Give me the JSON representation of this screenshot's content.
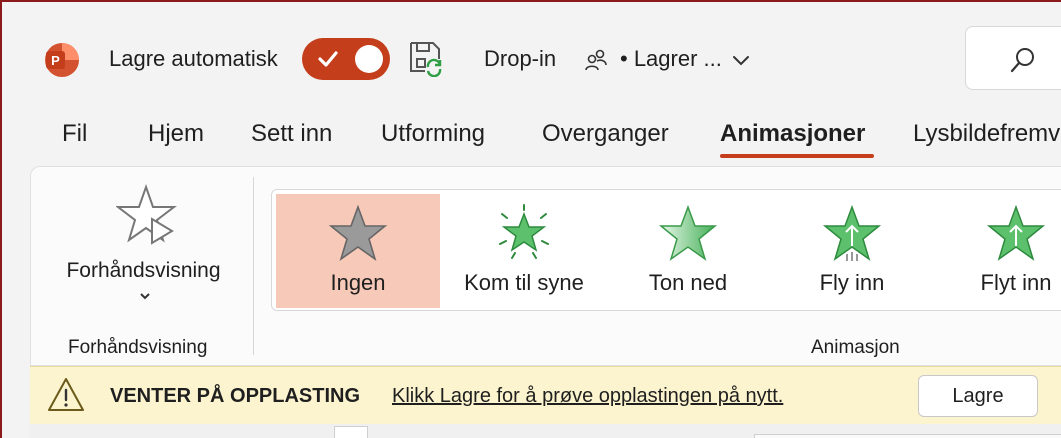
{
  "titlebar": {
    "autosave_label": "Lagre automatisk",
    "doc_title": "Drop-in",
    "save_status": "• Lagrer ...",
    "autosave_on": true
  },
  "tabs": [
    {
      "label": "Fil"
    },
    {
      "label": "Hjem"
    },
    {
      "label": "Sett inn"
    },
    {
      "label": "Utforming"
    },
    {
      "label": "Overganger"
    },
    {
      "label": "Animasjoner"
    },
    {
      "label": "Lysbildefremv"
    }
  ],
  "active_tab": "Animasjoner",
  "ribbon": {
    "preview": {
      "button_label": "Forhåndsvisning",
      "group_label": "Forhåndsvisning"
    },
    "animation": {
      "group_label": "Animasjon",
      "items": [
        {
          "label": "Ingen",
          "icon": "star-none-icon",
          "selected": true
        },
        {
          "label": "Kom til syne",
          "icon": "star-appear-icon",
          "selected": false
        },
        {
          "label": "Ton ned",
          "icon": "star-fade-icon",
          "selected": false
        },
        {
          "label": "Fly inn",
          "icon": "star-fly-in-icon",
          "selected": false
        },
        {
          "label": "Flyt inn",
          "icon": "star-float-in-icon",
          "selected": false
        }
      ]
    }
  },
  "notice": {
    "title": "VENTER PÅ OPPLASTING",
    "message": "Klikk Lagre for å prøve opplastingen på nytt.",
    "button": "Lagre"
  },
  "colors": {
    "accent": "#c43e1c",
    "selected_item": "#f7c9b8",
    "notice_bg": "#fcf4cf",
    "star_green": "#4caf50"
  }
}
